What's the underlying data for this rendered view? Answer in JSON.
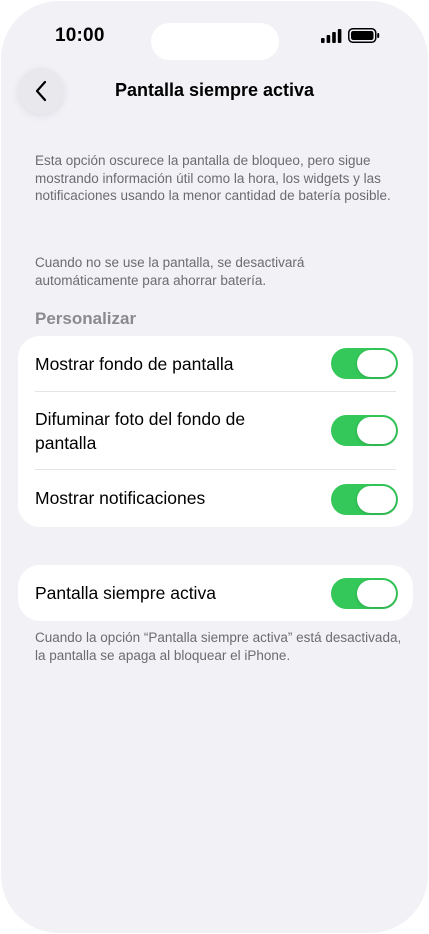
{
  "status_bar": {
    "time": "10:00"
  },
  "nav": {
    "back_icon": "chevron-left-icon",
    "title": "Pantalla siempre activa"
  },
  "description": {
    "paragraph_1": "Esta opción oscurece la pantalla de bloqueo, pero sigue mostrando información útil como la hora, los widgets y las notificaciones usando la menor cantidad de batería posible.",
    "paragraph_2": "Cuando no se use la pantalla, se desactivará automáticamente para ahorrar batería."
  },
  "customize": {
    "header": "Personalizar",
    "rows": [
      {
        "label": "Mostrar fondo de pantalla",
        "enabled": true
      },
      {
        "label": "Difuminar foto del fondo de pantalla",
        "enabled": true
      },
      {
        "label": "Mostrar notificaciones",
        "enabled": true
      }
    ]
  },
  "always_on": {
    "label": "Pantalla siempre activa",
    "enabled": true,
    "footer": "Cuando la opción “Pantalla siempre activa” está desactivada, la pantalla se apaga al bloquear el iPhone."
  },
  "colors": {
    "toggle_on": "#34c759",
    "background": "#f2f1f6"
  }
}
